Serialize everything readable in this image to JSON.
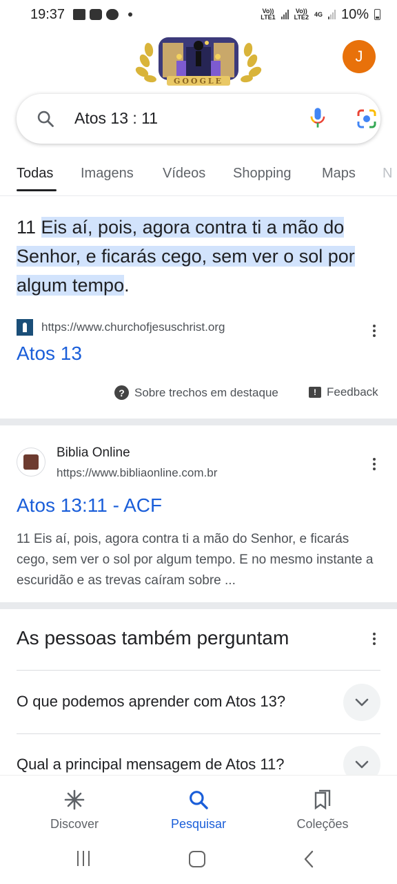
{
  "status_bar": {
    "time": "19:37",
    "network1": "Vo))\nLTE1",
    "network2": "Vo))\nLTE2",
    "net_type": "4G",
    "battery": "10%"
  },
  "header": {
    "avatar_letter": "J",
    "doodle_label": "GOOGLE"
  },
  "search": {
    "query": "Atos 13 : 11"
  },
  "tabs": [
    "Todas",
    "Imagens",
    "Vídeos",
    "Shopping",
    "Maps",
    "N"
  ],
  "snippet": {
    "verse_number": "11 ",
    "text": "Eis aí, pois, agora contra ti a mão do Senhor, e ficarás cego, sem ver o sol por algum tempo",
    "end": ".",
    "url": "https://www.churchofjesuschrist.org",
    "title": "Atos 13",
    "about_label": "Sobre trechos em destaque",
    "feedback_label": "Feedback"
  },
  "result2": {
    "site": "Biblia Online",
    "url": "https://www.bibliaonline.com.br",
    "title": "Atos 13:11 - ACF",
    "description": "11 Eis aí, pois, agora contra ti a mão do Senhor, e ficarás cego, sem ver o sol por algum tempo. E no mesmo instante a escuridão e as trevas caíram sobre ..."
  },
  "paa": {
    "title": "As pessoas também perguntam",
    "questions": [
      "O que podemos aprender com Atos 13?",
      "Qual a principal mensagem de Atos 11?"
    ]
  },
  "bottom_nav": {
    "discover": "Discover",
    "search": "Pesquisar",
    "collections": "Coleções"
  }
}
